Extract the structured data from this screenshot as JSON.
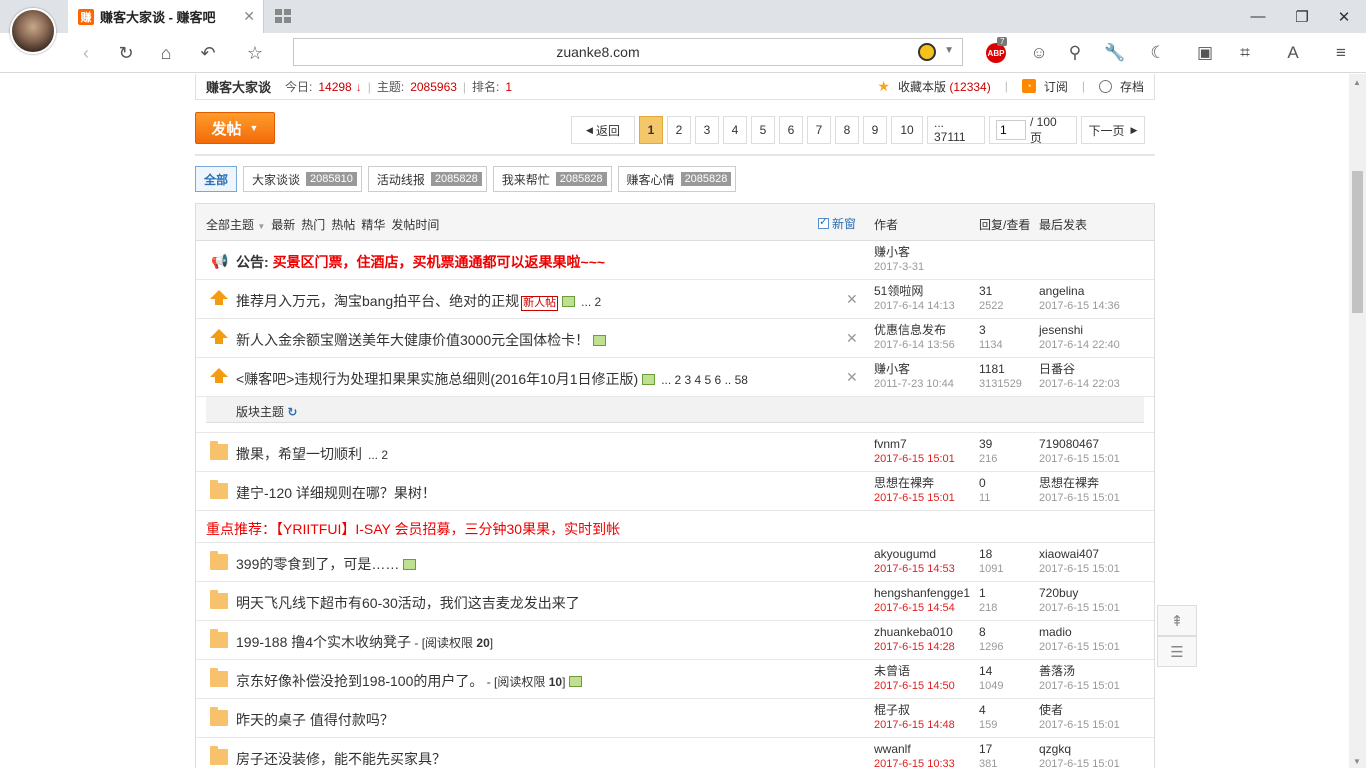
{
  "browser": {
    "tab_logo": "赚",
    "tab_title": "赚客大家谈 - 赚客吧",
    "url": "zuanke8.com",
    "abp_badge": "7",
    "abp_label": "ABP"
  },
  "forum": {
    "name": "赚客大家谈",
    "today_label": "今日:",
    "today": "14298",
    "topics_label": "主题:",
    "topics": "2085963",
    "rank_label": "排名:",
    "rank": "1",
    "fav": "收藏本版",
    "fav_count": "(12334)",
    "subscribe": "订阅",
    "archive": "存档"
  },
  "post_button": "发帖",
  "pager": {
    "back": "返回",
    "pages": [
      "1",
      "2",
      "3",
      "4",
      "5",
      "6",
      "7",
      "8",
      "9",
      "10",
      "... 37111"
    ],
    "input_value": "1",
    "total": "/ 100 页",
    "next": "下一页"
  },
  "filters": [
    {
      "label": "全部",
      "count": ""
    },
    {
      "label": "大家谈谈",
      "count": "2085810"
    },
    {
      "label": "活动线报",
      "count": "2085828"
    },
    {
      "label": "我来帮忙",
      "count": "2085828"
    },
    {
      "label": "赚客心情",
      "count": "2085828"
    }
  ],
  "table_head": {
    "links": [
      "全部主题",
      "最新",
      "热门",
      "热帖",
      "精华",
      "发帖时间"
    ],
    "new_window": "新窗",
    "author": "作者",
    "reply_view": "回复/查看",
    "last_post": "最后发表"
  },
  "notice": {
    "label": "公告:",
    "text": "买景区门票，住酒店，买机票通通都可以返果果啦~~~",
    "author": "赚小客",
    "date": "2017-3-31"
  },
  "sticky": [
    {
      "title": "推荐月入万元，淘宝bang拍平台、绝对的正规",
      "tag": "新人帖",
      "pages": "... 2",
      "author": "51领啦网",
      "date": "2017-6-14 14:13",
      "replies": "31",
      "views": "2522",
      "last_user": "angelina",
      "last_date": "2017-6-15 14:36"
    },
    {
      "title": "新人入金余额宝赠送美年大健康价值3000元全国体检卡！",
      "tag": "",
      "pages": "",
      "author": "优惠信息发布",
      "date": "2017-6-14 13:56",
      "replies": "3",
      "views": "1134",
      "last_user": "jesenshi",
      "last_date": "2017-6-14 22:40"
    },
    {
      "title": "<赚客吧>违规行为处理扣果果实施总细则(2016年10月1日修正版)",
      "tag": "",
      "pages": "... 2  3  4  5  6 .. 58",
      "author": "赚小客",
      "date": "2011-7-23 10:44",
      "replies": "1181",
      "views": "3131529",
      "last_user": "日番谷",
      "last_date": "2017-6-14 22:03"
    }
  ],
  "section_label": "版块主题",
  "threads_a": [
    {
      "title": "撒果，希望一切顺利",
      "pages": "... 2",
      "perm": "",
      "perm_val": "",
      "img": false,
      "author": "fvnm7",
      "date": "2017-6-15 15:01",
      "replies": "39",
      "views": "216",
      "last_user": "719080467",
      "last_date": "2017-6-15 15:01"
    },
    {
      "title": "建宁-120 详细规则在哪？果树！",
      "pages": "",
      "perm": "",
      "perm_val": "",
      "img": false,
      "author": "思想在裸奔",
      "date": "2017-6-15 15:01",
      "replies": "0",
      "views": "11",
      "last_user": "思想在裸奔",
      "last_date": "2017-6-15 15:01"
    }
  ],
  "promo": "重点推荐：【YRIITFUI】I-SAY 会员招募，三分钟30果果，实时到帐",
  "threads_b": [
    {
      "title": "399的零食到了，可是……",
      "pages": "",
      "perm": "",
      "perm_val": "",
      "img": true,
      "author": "akyougumd",
      "date": "2017-6-15 14:53",
      "replies": "18",
      "views": "1091",
      "last_user": "xiaowai407",
      "last_date": "2017-6-15 15:01"
    },
    {
      "title": "明天飞凡线下超市有60-30活动，我们这吉麦龙发出来了",
      "pages": "",
      "perm": "",
      "perm_val": "",
      "img": false,
      "author": "hengshanfengge1",
      "date": "2017-6-15 14:54",
      "replies": "1",
      "views": "218",
      "last_user": "720buy",
      "last_date": "2017-6-15 15:01"
    },
    {
      "title": "199-188 撸4个实木收纳凳子",
      "pages": "",
      "perm": " - [阅读权限 ",
      "perm_val": "20",
      "img": false,
      "author": "zhuankeba010",
      "date": "2017-6-15 14:28",
      "replies": "8",
      "views": "1296",
      "last_user": "madio",
      "last_date": "2017-6-15 15:01"
    },
    {
      "title": "京东好像补偿没抢到198-100的用户了。",
      "pages": "",
      "perm": " - [阅读权限 ",
      "perm_val": "10",
      "img": true,
      "author": "未曾语",
      "date": "2017-6-15 14:50",
      "replies": "14",
      "views": "1049",
      "last_user": "善落汤",
      "last_date": "2017-6-15 15:01"
    },
    {
      "title": "昨天的桌子 值得付款吗？",
      "pages": "",
      "perm": "",
      "perm_val": "",
      "img": false,
      "author": "棍子叔",
      "date": "2017-6-15 14:48",
      "replies": "4",
      "views": "159",
      "last_user": "使者",
      "last_date": "2017-6-15 15:01"
    },
    {
      "title": "房子还没装修，能不能先买家具？",
      "pages": "",
      "perm": "",
      "perm_val": "",
      "img": false,
      "author": "wwanlf",
      "date": "2017-6-15 10:33",
      "replies": "17",
      "views": "381",
      "last_user": "qzgkq",
      "last_date": "2017-6-15 15:01"
    }
  ]
}
